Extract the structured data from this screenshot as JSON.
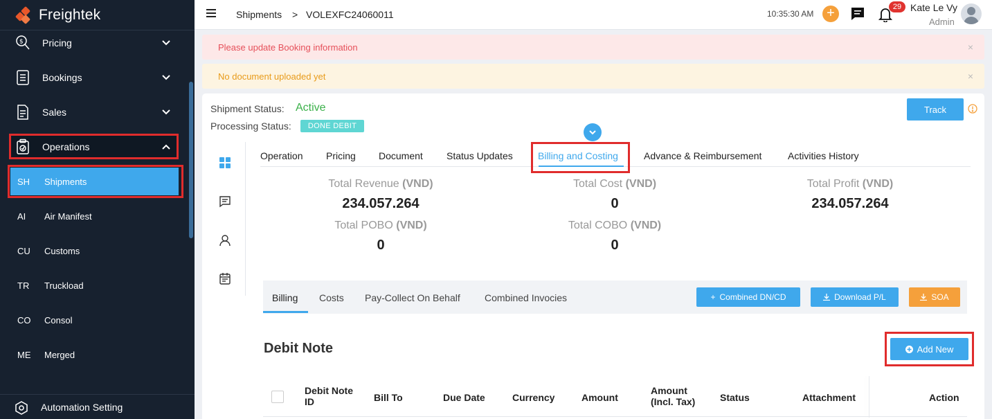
{
  "app": {
    "name": "Freightek"
  },
  "sidebar": {
    "items": [
      {
        "label": "Pricing"
      },
      {
        "label": "Bookings"
      },
      {
        "label": "Sales"
      },
      {
        "label": "Operations"
      }
    ],
    "sub_items": [
      {
        "abbr": "SH",
        "label": "Shipments"
      },
      {
        "abbr": "AI",
        "label": "Air Manifest"
      },
      {
        "abbr": "CU",
        "label": "Customs"
      },
      {
        "abbr": "TR",
        "label": "Truckload"
      },
      {
        "abbr": "CO",
        "label": "Consol"
      },
      {
        "abbr": "ME",
        "label": "Merged"
      }
    ],
    "bottom": {
      "label": "Automation Setting"
    }
  },
  "header": {
    "breadcrumb_root": "Shipments",
    "breadcrumb_sep": ">",
    "breadcrumb_current": "VOLEXFC24060011",
    "time": "10:35:30 AM",
    "notifications": "29",
    "user_name": "Kate Le Vy",
    "user_role": "Admin"
  },
  "alerts": {
    "booking": "Please update Booking information",
    "document": "No document uploaded yet",
    "close": "×"
  },
  "shipment": {
    "status_label": "Shipment Status:",
    "status_value": "Active",
    "processing_label": "Processing Status:",
    "processing_value": "DONE DEBIT",
    "track_label": "Track"
  },
  "tabs": [
    {
      "label": "Operation"
    },
    {
      "label": "Pricing"
    },
    {
      "label": "Document"
    },
    {
      "label": "Status Updates"
    },
    {
      "label": "Billing and Costing"
    },
    {
      "label": "Advance & Reimbursement"
    },
    {
      "label": "Activities History"
    }
  ],
  "summary": {
    "unit": "(VND)",
    "revenue_label": "Total Revenue",
    "revenue_value": "234.057.264",
    "cost_label": "Total Cost",
    "cost_value": "0",
    "profit_label": "Total Profit",
    "profit_value": "234.057.264",
    "pobo_label": "Total POBO",
    "pobo_value": "0",
    "cobo_label": "Total COBO",
    "cobo_value": "0"
  },
  "subtabs": [
    {
      "label": "Billing"
    },
    {
      "label": "Costs"
    },
    {
      "label": "Pay-Collect On Behalf"
    },
    {
      "label": "Combined Invocies"
    }
  ],
  "actions": {
    "combined": "Combined DN/CD",
    "download": "Download P/L",
    "soa": "SOA",
    "add_new": "Add New"
  },
  "debit_note": {
    "title": "Debit Note",
    "columns": [
      "Debit Note ID",
      "Bill To",
      "Due Date",
      "Currency",
      "Amount",
      "Amount (Incl. Tax)",
      "Status",
      "Attachment",
      "Action"
    ]
  },
  "colors": {
    "accent": "#3fa8ec",
    "active_green": "#3bb14a",
    "brand_orange": "#e8572a",
    "warning": "#f5a03b",
    "highlight_red": "#e02c2c"
  }
}
